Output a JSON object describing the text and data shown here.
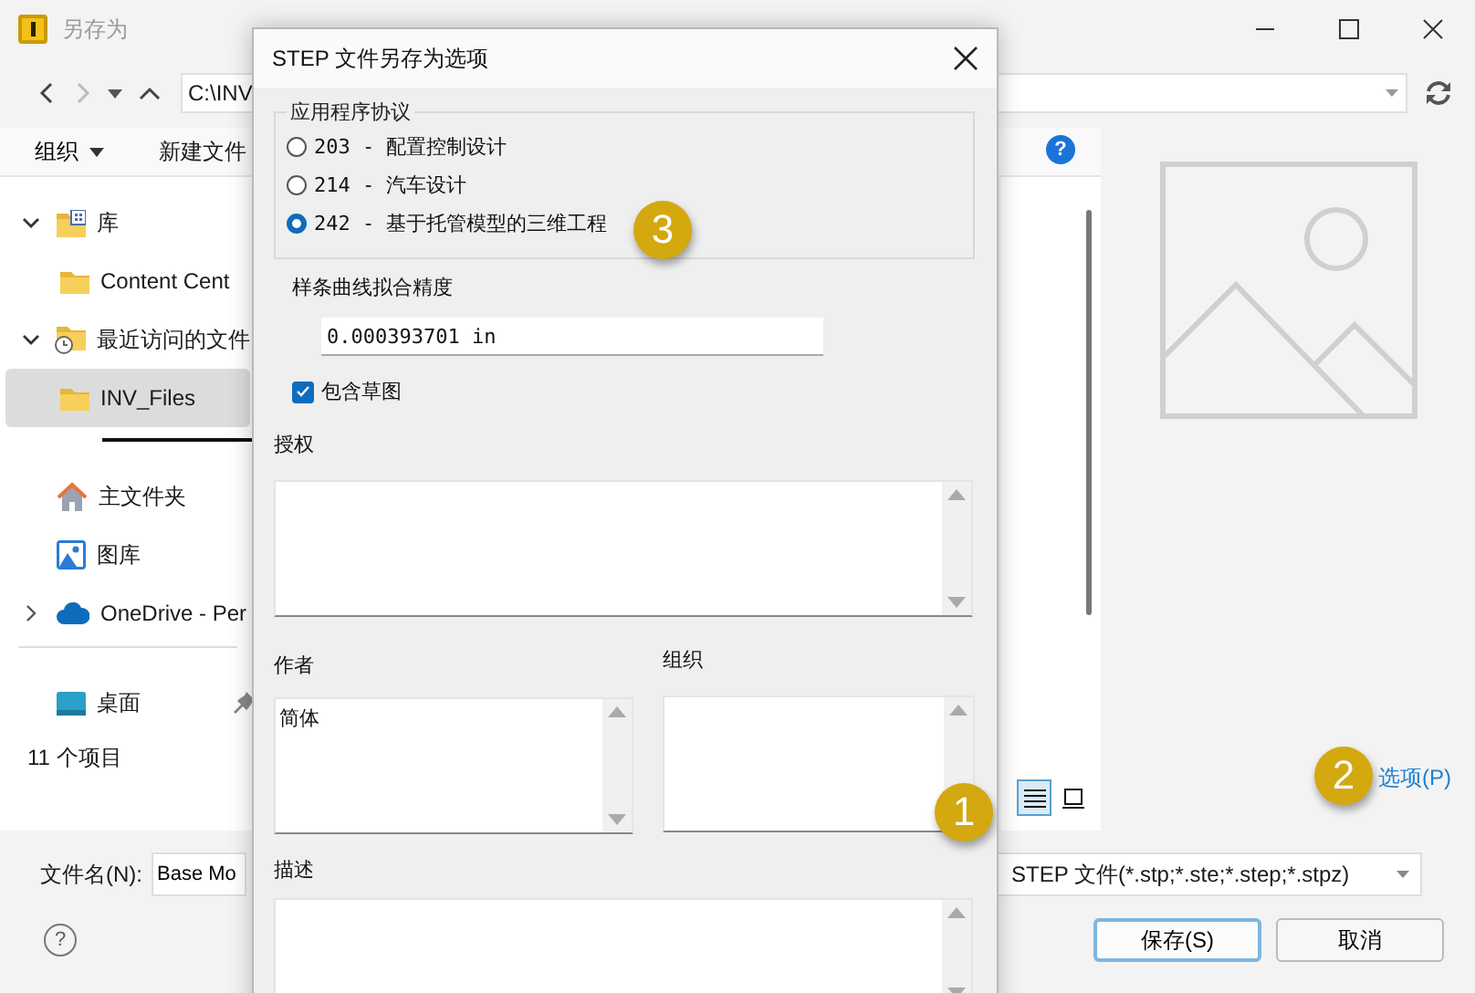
{
  "window": {
    "title": "另存为"
  },
  "address_bar": {
    "path": "C:\\INV"
  },
  "toolbar": {
    "organize": "组织",
    "new_folder": "新建文件",
    "help": "?"
  },
  "nav": {
    "groups": [
      [
        {
          "label": "库",
          "kind": "library",
          "expanded": true,
          "selected": false,
          "children": [
            {
              "label": "Content Cent",
              "kind": "folder",
              "selected": false
            }
          ]
        },
        {
          "label": "最近访问的文件",
          "kind": "recent",
          "expanded": true,
          "selected": false,
          "children": [
            {
              "label": "INV_Files",
              "kind": "folder",
              "selected": true
            }
          ]
        }
      ],
      [
        {
          "label": "主文件夹",
          "kind": "home",
          "selected": false
        },
        {
          "label": "图库",
          "kind": "gallery",
          "selected": false
        },
        {
          "label": "OneDrive - Per",
          "kind": "cloud",
          "expanded": false,
          "selected": false
        }
      ],
      [
        {
          "label": "桌面",
          "kind": "desktop",
          "selected": false,
          "pinned": true
        }
      ]
    ]
  },
  "status": "11 个项目",
  "view_buttons": [
    {
      "kind": "details",
      "selected": true
    },
    {
      "kind": "preview",
      "selected": false
    }
  ],
  "options_link": {
    "label": "选项(P)",
    "callout": "2"
  },
  "file_name": {
    "label": "文件名(N):",
    "value": "Base Mo"
  },
  "file_type": {
    "value": "STEP 文件(*.stp;*.ste;*.step;*.stpz)"
  },
  "footer_help": "?",
  "buttons": [
    {
      "label": "保存(S)",
      "default": true
    },
    {
      "label": "取消",
      "default": false
    }
  ],
  "dialog": {
    "title": "STEP 文件另存为选项",
    "protocol": {
      "legend": "应用程序协议",
      "callout": "3",
      "options": [
        {
          "label": "203 - 配置控制设计",
          "selected": false
        },
        {
          "label": "214 - 汽车设计",
          "selected": false
        },
        {
          "label": "242 - 基于托管模型的三维工程",
          "selected": true
        }
      ]
    },
    "precision": {
      "label": "样条曲线拟合精度",
      "value": "0.000393701 in"
    },
    "include_sketch": {
      "label": "包含草图",
      "checked": true
    },
    "authorization": {
      "label": "授权"
    },
    "author": {
      "label": "作者",
      "value": "简体"
    },
    "organization": {
      "label": "组织",
      "callout": "1"
    },
    "description": {
      "label": "描述"
    }
  }
}
